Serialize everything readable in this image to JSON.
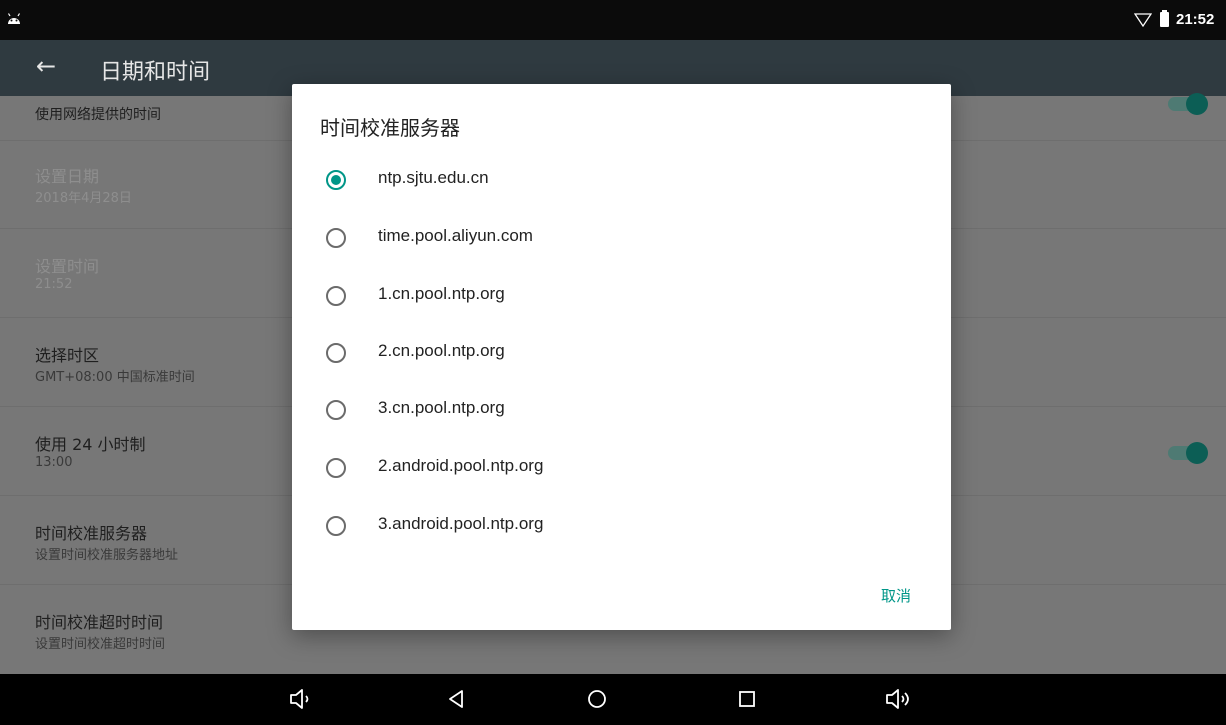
{
  "status_bar": {
    "time": "21:52"
  },
  "app_bar": {
    "back_icon": "arrow-left-icon",
    "title": "日期和时间"
  },
  "settings": [
    {
      "title": "",
      "summary": "使用网络提供的时间",
      "enabled": true,
      "switch": true
    },
    {
      "title": "设置日期",
      "summary": "2018年4月28日",
      "enabled": false
    },
    {
      "title": "设置时间",
      "summary": "21:52",
      "enabled": false
    },
    {
      "title": "选择时区",
      "summary": "GMT+08:00 中国标准时间",
      "enabled": true
    },
    {
      "title": "使用 24 小时制",
      "summary": "13:00",
      "enabled": true,
      "switch": true
    },
    {
      "title": "时间校准服务器",
      "summary": "设置时间校准服务器地址",
      "enabled": true
    },
    {
      "title": "时间校准超时时间",
      "summary": "设置时间校准超时时间",
      "enabled": true
    }
  ],
  "dialog": {
    "title": "时间校准服务器",
    "options": [
      {
        "label": "ntp.sjtu.edu.cn",
        "selected": true
      },
      {
        "label": "time.pool.aliyun.com",
        "selected": false
      },
      {
        "label": "1.cn.pool.ntp.org",
        "selected": false
      },
      {
        "label": "2.cn.pool.ntp.org",
        "selected": false
      },
      {
        "label": "3.cn.pool.ntp.org",
        "selected": false
      },
      {
        "label": "2.android.pool.ntp.org",
        "selected": false
      },
      {
        "label": "3.android.pool.ntp.org",
        "selected": false
      }
    ],
    "cancel_label": "取消"
  },
  "nav_bar": {
    "buttons": [
      "volume-down-icon",
      "back-triangle-icon",
      "home-circle-icon",
      "recents-square-icon",
      "volume-up-icon"
    ]
  },
  "colors": {
    "accent": "#009688",
    "app_bar": "#2f3a40",
    "status_bar": "#0b0b0b"
  }
}
